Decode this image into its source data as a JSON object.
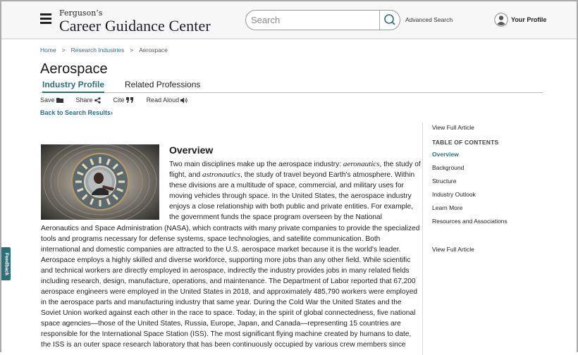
{
  "header": {
    "brand_small": "Ferguson’s",
    "brand_title": "Career Guidance Center",
    "search_placeholder": "Search",
    "advanced_search": "Advanced Search",
    "profile_label": "Your Profile"
  },
  "breadcrumb": [
    {
      "label": "Home"
    },
    {
      "label": "Research Industries"
    },
    {
      "label": "Aerospace"
    }
  ],
  "breadcrumb_separator": ">",
  "page": {
    "title": "Aerospace",
    "tabs": [
      {
        "label": "Industry Profile",
        "active": true
      },
      {
        "label": "Related Professions",
        "active": false
      }
    ],
    "actions": [
      {
        "label": "Save",
        "icon": "folder-icon"
      },
      {
        "label": "Share",
        "icon": "share-icon"
      },
      {
        "label": "Cite",
        "icon": "quote-icon"
      },
      {
        "label": "Read Aloud",
        "icon": "speaker-icon"
      }
    ],
    "back_link": "Back to Search Results›"
  },
  "sidebar": {
    "view_full_article_top": "View Full Article",
    "toc_heading": "TABLE OF CONTENTS",
    "toc": [
      {
        "label": "Overview",
        "active": true
      },
      {
        "label": "Background"
      },
      {
        "label": "Structure"
      },
      {
        "label": "Industry Outlook"
      },
      {
        "label": "Learn More"
      },
      {
        "label": "Resources and Associations"
      }
    ],
    "view_full_article_bottom": "View Full Article"
  },
  "article": {
    "image_alt": "Worker inside a jet engine",
    "heading": "Overview",
    "lines_wrapped": [
      {
        "pre": "Two main disciplines make up the aerospace industry: ",
        "em": "aeronautics",
        "post": ", the study of"
      },
      {
        "pre": "flight, and ",
        "em": "astronautics",
        "post": ", the study of travel beyond Earth's atmosphere. Within"
      },
      {
        "pre": "these divisions are a multitude of space, commercial, and military uses for"
      },
      {
        "pre": "moving vehicles through space. In the United States, the aerospace industry"
      },
      {
        "pre": "enjoys a close relationship with both public and private entities. For example,"
      },
      {
        "pre": "the government funds the space program overseen by the National"
      }
    ],
    "lines_full": [
      "Aeronautics and Space Administration (NASA), which contracts with many private companies to provide the specialized",
      "tools and programs necessary for defense systems, space technologies, and satellite communication. Both",
      "international and domestic companies are attracted to the U.S. aerospace market because it is the world's leader.",
      "Aerospace employs a highly skilled and diverse workforce, supporting more jobs than any other field. While scientific",
      "and technical workers are directly employed in aerospace, indirectly the industry provides jobs in many related fields",
      "including research, design, manufacture, operations, and maintenance. The Department of Labor reported that 67,200",
      "aerospace engineers were employed in the United States in 2018, and approximately 485,790 workers were employed",
      "in the aerospace parts and manufacturing industry that same year. During the Cold War the United States and the",
      "Soviet Union worked against each other in the race to space. Today, in the spirit of global connectedness, five national",
      "space agencies—those of the United States, Russia, Europe, Japan, and Canada—representing 15 countries are",
      "responsible for the International Space Station (ISS). The most significant flying machine created by humans to date,",
      "the ISS is an outer space research laboratory that has been continuously occupied by various crew members since"
    ]
  },
  "feedback_tab": "Feedback",
  "colors": {
    "accent": "#2a6f7a",
    "header_bg": "#f7f7f7"
  }
}
